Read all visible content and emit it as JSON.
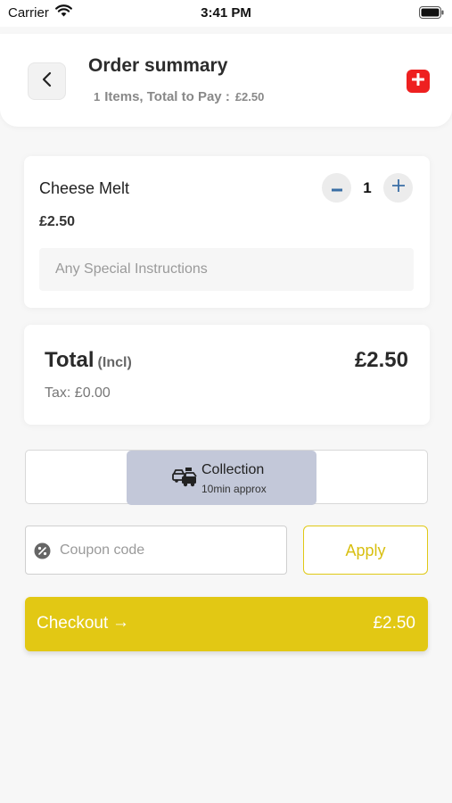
{
  "status_bar": {
    "carrier": "Carrier",
    "time": "3:41 PM"
  },
  "header": {
    "title": "Order summary",
    "item_count": "1",
    "items_label": "Items, Total to Pay :",
    "total": "£2.50"
  },
  "cart": {
    "items": [
      {
        "name": "Cheese Melt",
        "price": "£2.50",
        "quantity": "1",
        "instructions_placeholder": "Any Special Instructions"
      }
    ]
  },
  "totals": {
    "label": "Total",
    "incl_label": "(Incl)",
    "amount": "£2.50",
    "tax_line": "Tax: £0.00"
  },
  "order_type": {
    "selected": {
      "name": "Collection",
      "time": "10min approx"
    }
  },
  "coupon": {
    "placeholder": "Coupon code",
    "apply_label": "Apply"
  },
  "checkout": {
    "label": "Checkout",
    "arrow": "→",
    "amount": "£2.50"
  },
  "colors": {
    "accent_yellow": "#e2c814",
    "danger_red": "#ee2020",
    "selected_type_bg": "#c3c8d9",
    "qty_icon_blue": "#3a6ea5"
  },
  "icons": {
    "wifi": "wifi-icon",
    "battery": "battery-icon",
    "back": "chevron-left-icon",
    "add": "plus-icon",
    "minus": "minus-icon",
    "plus": "plus-icon",
    "collection": "car-shop-icon",
    "coupon": "percent-badge-icon"
  }
}
